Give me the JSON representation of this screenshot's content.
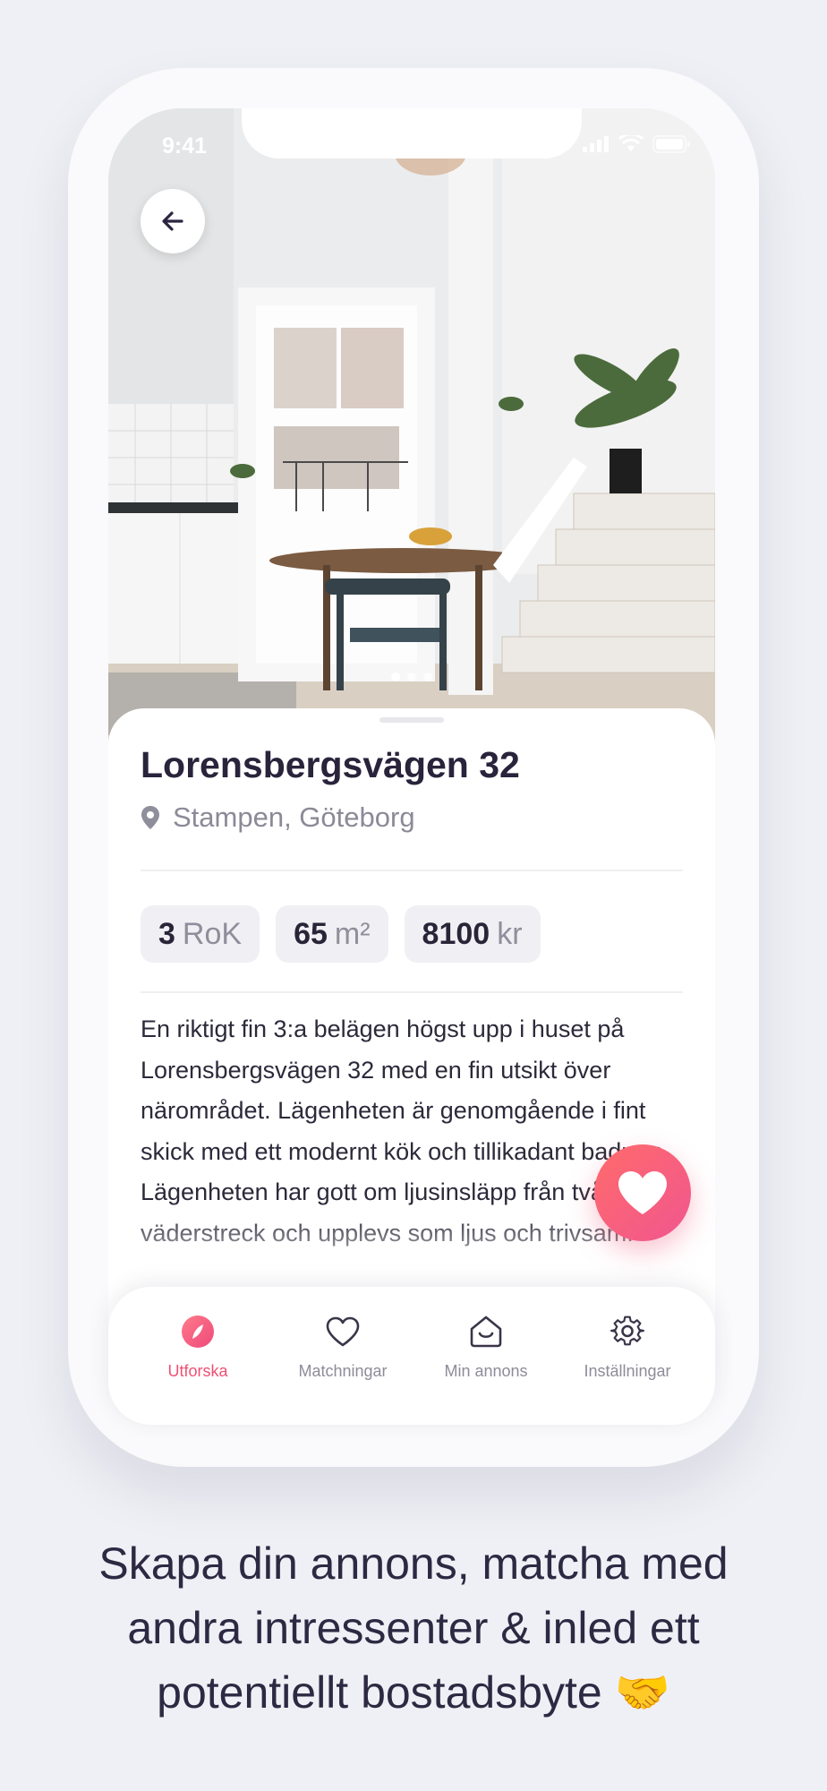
{
  "status_bar": {
    "time": "9:41"
  },
  "listing": {
    "title": "Lorensbergsvägen 32",
    "location": "Stampen, Göteborg",
    "chips": [
      {
        "value": "3",
        "unit": "RoK"
      },
      {
        "value": "65",
        "unit": "m²"
      },
      {
        "value": "8100",
        "unit": "kr"
      }
    ],
    "description": "En riktigt fin 3:a belägen högst upp i huset på Lorensbergsvägen 32 med en fin utsikt över närområdet. Lägenheten är genomgående i fint skick med ett modernt kök och tillikadant badrum. Lägenheten har gott om ljusinsläpp från två väderstreck och upplevs som ljus och trivsam."
  },
  "gallery": {
    "pages": 3,
    "current": 1
  },
  "tabbar": {
    "items": [
      {
        "label": "Utforska",
        "icon": "compass-icon",
        "active": true
      },
      {
        "label": "Matchningar",
        "icon": "heart-outline-icon",
        "active": false
      },
      {
        "label": "Min annons",
        "icon": "house-smile-icon",
        "active": false
      },
      {
        "label": "Inställningar",
        "icon": "gear-icon",
        "active": false
      }
    ]
  },
  "caption": "Skapa din annons, matcha med andra intressenter & inled ett potentiellt bostadsbyte 🤝",
  "colors": {
    "accent": "#ef4f74",
    "text": "#29233b",
    "muted": "#8b8a97",
    "background": "#eff0f5"
  }
}
